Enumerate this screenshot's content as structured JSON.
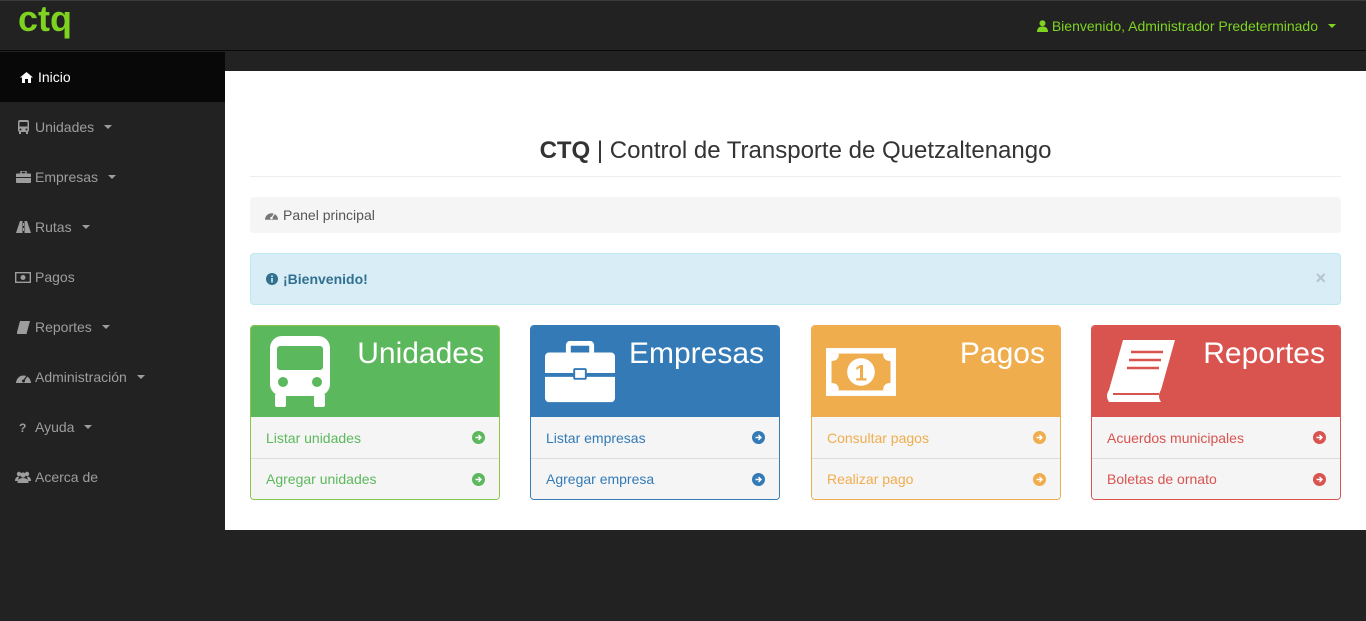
{
  "topbar": {
    "logo_text": "ctq",
    "user_menu_label": "Bienvenido, Administrador Predeterminado",
    "accent_color": "#7ed321"
  },
  "sidebar": {
    "items": [
      {
        "label": "Inicio",
        "icon": "home-icon",
        "active": true,
        "dropdown": false
      },
      {
        "label": "Unidades",
        "icon": "bus-icon",
        "active": false,
        "dropdown": true
      },
      {
        "label": "Empresas",
        "icon": "briefcase-icon",
        "active": false,
        "dropdown": true
      },
      {
        "label": "Rutas",
        "icon": "road-icon",
        "active": false,
        "dropdown": true
      },
      {
        "label": "Pagos",
        "icon": "money-icon",
        "active": false,
        "dropdown": false
      },
      {
        "label": "Reportes",
        "icon": "book-icon",
        "active": false,
        "dropdown": true
      },
      {
        "label": "Administración",
        "icon": "dashboard-icon",
        "active": false,
        "dropdown": true
      },
      {
        "label": "Ayuda",
        "icon": "question-icon",
        "active": false,
        "dropdown": true
      },
      {
        "label": "Acerca de",
        "icon": "users-icon",
        "active": false,
        "dropdown": false
      }
    ]
  },
  "main": {
    "header_bold": "CTQ",
    "header_rest": " | Control de Transporte de Quetzaltenango",
    "breadcrumb": "Panel principal",
    "alert_text": "¡Bienvenido!",
    "alert_close": "×",
    "panels": [
      {
        "title": "Unidades",
        "icon": "bus-icon",
        "color": "#5cb85c",
        "links": [
          "Listar unidades",
          "Agregar unidades"
        ]
      },
      {
        "title": "Empresas",
        "icon": "briefcase-icon",
        "color": "#337ab7",
        "links": [
          "Listar empresas",
          "Agregar empresa"
        ]
      },
      {
        "title": "Pagos",
        "icon": "money-icon",
        "color": "#f0ad4e",
        "links": [
          "Consultar pagos",
          "Realizar pago"
        ]
      },
      {
        "title": "Reportes",
        "icon": "book-icon",
        "color": "#d9534f",
        "links": [
          "Acuerdos municipales",
          "Boletas de ornato"
        ]
      }
    ]
  }
}
